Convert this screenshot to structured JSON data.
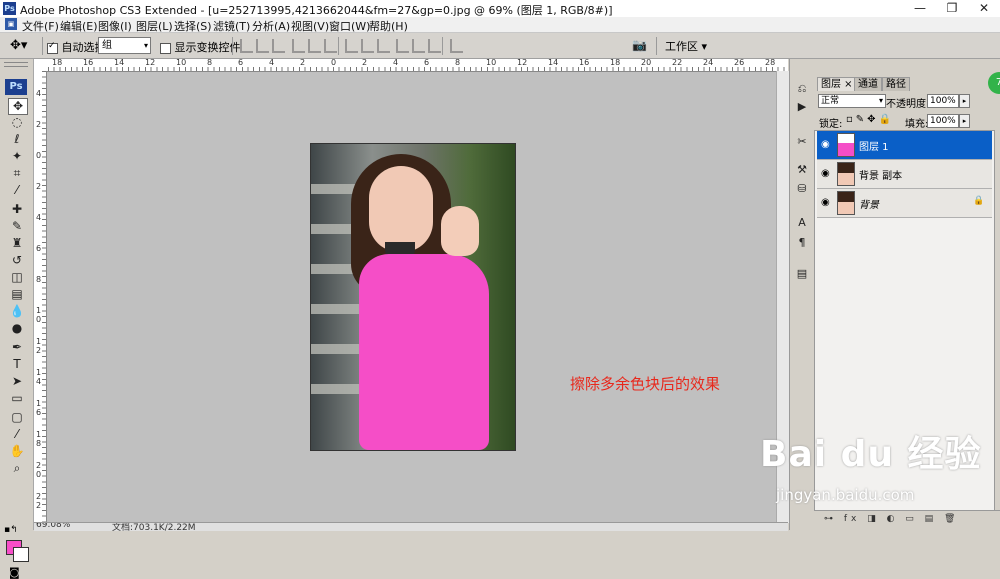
{
  "app": {
    "ps_badge": "Ps",
    "title": "Adobe Photoshop CS3 Extended - [u=252713995,4213662044&fm=27&gp=0.jpg @ 69% (图层 1, RGB/8#)]",
    "window_buttons": [
      "—",
      "❐",
      "✕"
    ]
  },
  "menu": [
    "文件(F)",
    "编辑(E)",
    "图像(I)",
    "图层(L)",
    "选择(S)",
    "滤镜(T)",
    "分析(A)",
    "视图(V)",
    "窗口(W)",
    "帮助(H)"
  ],
  "options": {
    "auto_select_label": "自动选择:",
    "auto_select_checked": true,
    "auto_select_value": "组",
    "show_transform_label": "显示变换控件",
    "show_transform_checked": false,
    "workspace_label": "工作区"
  },
  "ruler": {
    "h_labels": [
      "18",
      "16",
      "14",
      "12",
      "10",
      "8",
      "6",
      "4",
      "2",
      "0",
      "2",
      "4",
      "6",
      "8",
      "10",
      "12",
      "14",
      "16",
      "18",
      "20",
      "22",
      "24",
      "26",
      "28"
    ],
    "v_labels": [
      "4",
      "2",
      "0",
      "2",
      "4",
      "6",
      "8",
      "1 0",
      "1 2",
      "1 4",
      "1 6",
      "1 8",
      "2 0",
      "2 2"
    ]
  },
  "status": {
    "zoom": "69.08%",
    "doc": "文档:703.1K/2.22M"
  },
  "annotation": "擦除多余色块后的效果",
  "colors": {
    "foreground": "#f74ec8",
    "background": "#ffffff",
    "annotation": "#e8281c",
    "selection": "#0a5fc7"
  },
  "layers_panel": {
    "tabs": [
      "图层 ×",
      "通道",
      "路径"
    ],
    "blend_mode": "正常",
    "opacity_label": "不透明度:",
    "opacity_value": "100%",
    "lock_label": "锁定:",
    "fill_label": "填充:",
    "fill_value": "100%",
    "layers": [
      {
        "name": "图层 1",
        "selected": true
      },
      {
        "name": "背景 副本",
        "selected": false
      },
      {
        "name": "背景",
        "selected": false,
        "locked": true
      }
    ]
  },
  "watermark": {
    "brand": "Bai du 经验",
    "url": "jingyan.baidu.com",
    "badge": "7"
  }
}
